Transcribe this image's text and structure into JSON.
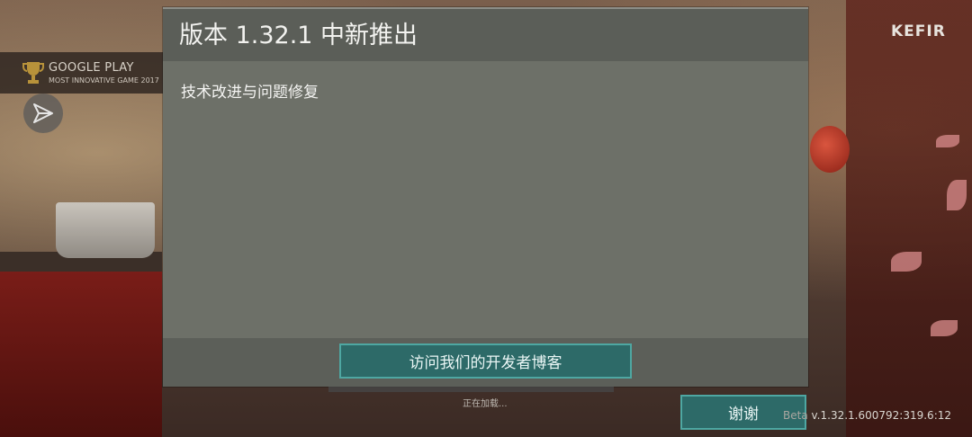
{
  "badge": {
    "title": "GOOGLE PLAY",
    "subtitle": "MOST INNOVATIVE GAME 2017"
  },
  "brand": {
    "logo_text": "KEFIR"
  },
  "dialog": {
    "title": "版本 1.32.1 中新推出",
    "body": "技术改进与问题修复",
    "blog_button_label": "访问我们的开发者博客"
  },
  "loading": {
    "text": "正在加载..."
  },
  "footer": {
    "thanks_label": "谢谢",
    "beta_label": "Beta",
    "version": "v.1.32.1.600792:319.6:12"
  },
  "colors": {
    "dialog_bg": "#6d7068",
    "dialog_header": "#5b5e58",
    "button_fill": "#2d6a68",
    "button_border": "#4ea7a2"
  },
  "icons": {
    "badge": "trophy-icon",
    "share": "share-icon"
  }
}
